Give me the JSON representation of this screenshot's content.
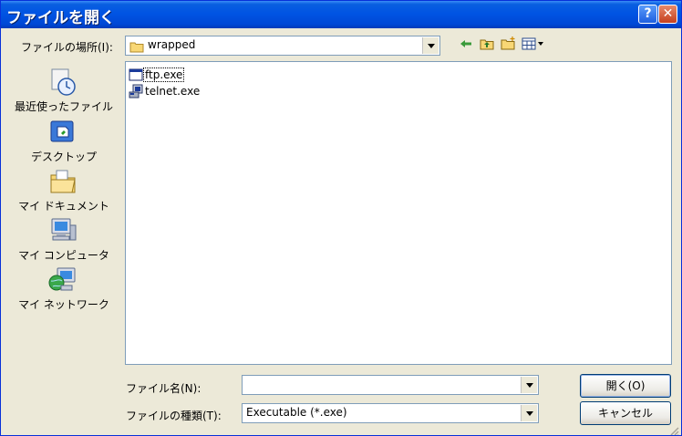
{
  "window": {
    "title": "ファイルを開く"
  },
  "lookin": {
    "label": "ファイルの場所(I):",
    "value": "wrapped"
  },
  "toolbar": {
    "icons": [
      "back-arrow-icon",
      "up-folder-icon",
      "new-folder-icon",
      "view-menu-icon"
    ]
  },
  "places": [
    {
      "label": "最近使ったファイル",
      "icon": "recent-documents-icon"
    },
    {
      "label": "デスクトップ",
      "icon": "desktop-icon"
    },
    {
      "label": "マイ ドキュメント",
      "icon": "my-documents-icon"
    },
    {
      "label": "マイ コンピュータ",
      "icon": "my-computer-icon"
    },
    {
      "label": "マイ ネットワーク",
      "icon": "my-network-icon"
    }
  ],
  "files": [
    {
      "name": "ftp.exe",
      "icon": "exe-window-icon",
      "selected": true
    },
    {
      "name": "telnet.exe",
      "icon": "exe-terminal-icon",
      "selected": false
    }
  ],
  "filename": {
    "label": "ファイル名(N):",
    "value": ""
  },
  "filetype": {
    "label": "ファイルの種類(T):",
    "value": "Executable (*.exe)"
  },
  "buttons": {
    "open": "開く(O)",
    "cancel": "キャンセル"
  },
  "colors": {
    "titlebar": "#0054E3",
    "face": "#ECE9D8",
    "border": "#7F9DB9"
  }
}
